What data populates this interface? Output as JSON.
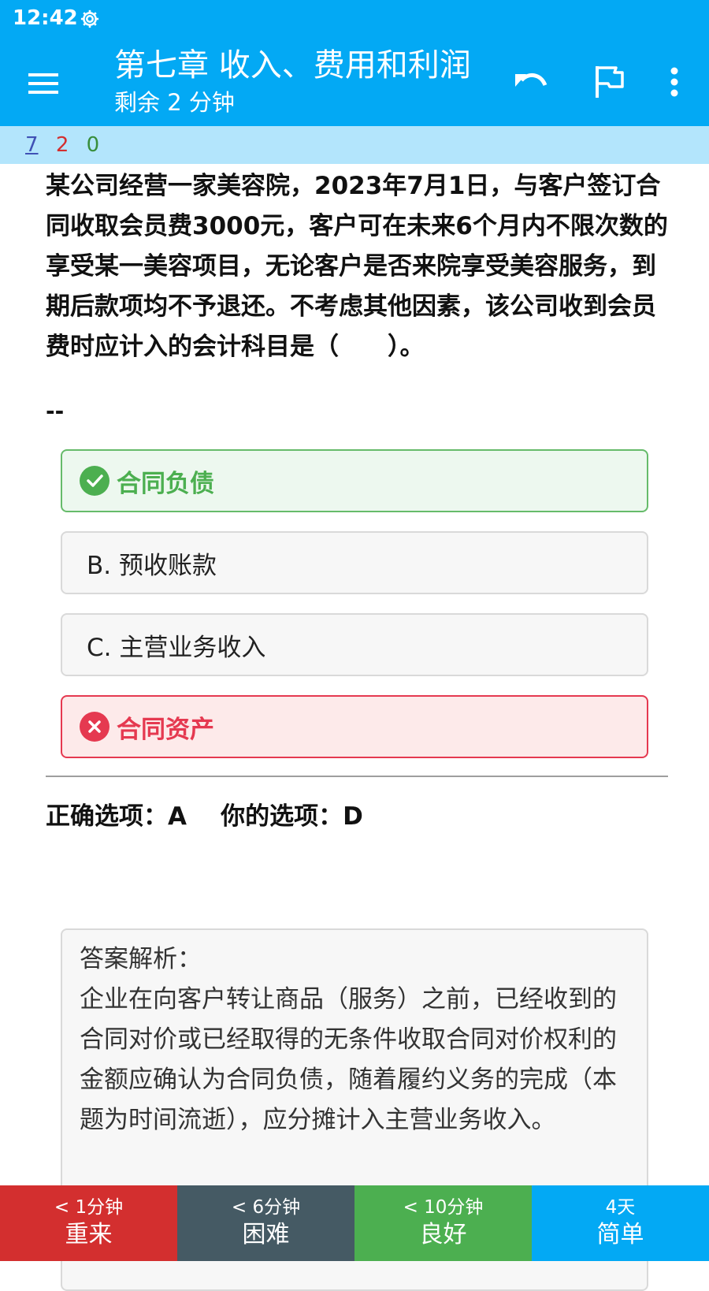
{
  "status_bar": {
    "time": "12:42",
    "settings_icon": "gear-icon"
  },
  "app_bar": {
    "title": "第七章 收入、费用和利润",
    "subtitle": "剩余 2 分钟",
    "icons": [
      "menu-icon",
      "undo-icon",
      "flag-icon",
      "more-vert-icon"
    ]
  },
  "counts": {
    "new": "7",
    "learning": "2",
    "review": "0"
  },
  "question": {
    "text": "某公司经营一家美容院，2023年7月1日，与客户签订合同收取会员费3000元，客户可在未来6个月内不限次数的享受某一美容项目，无论客户是否来院享受美容服务，到期后款项均不予退还。不考虑其他因素，该公司收到会员费时应计入的会计科目是（　　）。",
    "separator": "--"
  },
  "options": [
    {
      "label": "合同负债",
      "state": "correct"
    },
    {
      "label": "B. 预收账款",
      "state": "normal"
    },
    {
      "label": "C. 主营业务收入",
      "state": "normal"
    },
    {
      "label": "合同资产",
      "state": "wrong"
    }
  ],
  "result": {
    "correct_label": "正确选项：",
    "correct_value": "A",
    "yours_label": "你的选项：",
    "yours_value": "D"
  },
  "explanation": {
    "heading": "答案解析：",
    "body": "企业在向客户转让商品（服务）之前，已经收到的合同对价或已经取得的无条件收取合同对价权利的金额应确认为合同负债，随着履约义务的完成（本题为时间流逝），应分摊计入主营业务收入。"
  },
  "answer_buttons": [
    {
      "interval": "< 1分钟",
      "label": "重来"
    },
    {
      "interval": "< 6分钟",
      "label": "困难"
    },
    {
      "interval": "< 10分钟",
      "label": "良好"
    },
    {
      "interval": "4天",
      "label": "简单"
    }
  ],
  "colors": {
    "primary": "#03a9f4",
    "count_bar": "#b3e5fc",
    "correct": "#4caf50",
    "wrong": "#e53950",
    "again": "#d32f2f",
    "hard": "#455a64",
    "good": "#4caf50",
    "easy": "#03a9f4"
  }
}
